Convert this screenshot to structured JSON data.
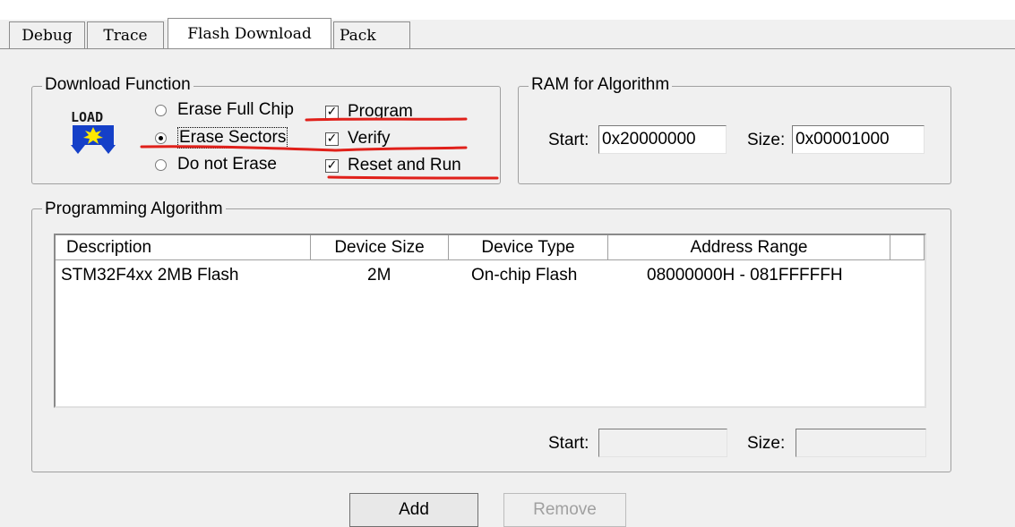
{
  "tabs": [
    "Debug",
    "Trace",
    "Flash Download",
    "Pack"
  ],
  "selected_tab": "Flash Download",
  "download_function": {
    "legend": "Download Function",
    "icon_text": "LOAD",
    "radios": [
      {
        "label": "Erase Full Chip",
        "checked": false
      },
      {
        "label": "Erase Sectors",
        "checked": true
      },
      {
        "label": "Do not Erase",
        "checked": false
      }
    ],
    "checkboxes": [
      {
        "label": "Program",
        "checked": true
      },
      {
        "label": "Verify",
        "checked": true
      },
      {
        "label": "Reset and Run",
        "checked": true
      }
    ]
  },
  "ram_for_algorithm": {
    "legend": "RAM for Algorithm",
    "start_label": "Start:",
    "start_value": "0x20000000",
    "size_label": "Size:",
    "size_value": "0x00001000"
  },
  "programming_algorithm": {
    "legend": "Programming Algorithm",
    "columns": [
      "Description",
      "Device Size",
      "Device Type",
      "Address Range"
    ],
    "rows": [
      {
        "description": "STM32F4xx 2MB Flash",
        "device_size": "2M",
        "device_type": "On-chip Flash",
        "address_range": "08000000H - 081FFFFFH"
      }
    ],
    "start_label": "Start:",
    "start_value": "",
    "size_label": "Size:",
    "size_value": ""
  },
  "buttons": {
    "add": "Add",
    "remove": "Remove"
  },
  "colors": {
    "annotation": "#e0201a",
    "background": "#f0f0f0"
  }
}
